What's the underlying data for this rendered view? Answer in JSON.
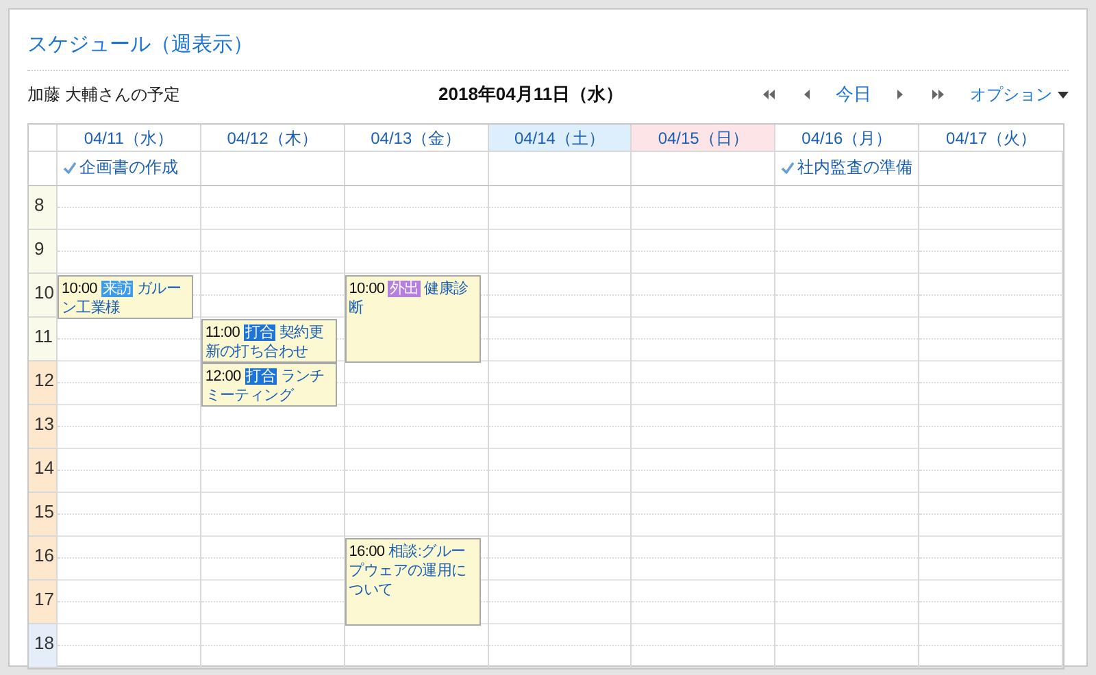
{
  "title": "スケジュール（週表示）",
  "owner": "加藤 大輔さんの予定",
  "current_date": "2018年04月11日（水）",
  "navigation": {
    "today": "今日",
    "options": "オプション"
  },
  "days": [
    {
      "label": "04/11（水）",
      "kind": "weekday",
      "all_day": [
        "企画書の作成"
      ],
      "events": [
        {
          "time": "10:00",
          "tag": "来訪",
          "color": "#3d9be9",
          "title": "ガルーン工業様",
          "kind": "one-hour"
        }
      ]
    },
    {
      "label": "04/12（木）",
      "kind": "weekday",
      "events": [
        {
          "time": "11:00",
          "tag": "打合",
          "color": "#1e74d6",
          "title": "契約更新の打ち合わせ",
          "kind": "one-hour"
        },
        {
          "time": "12:00",
          "tag": "打合",
          "color": "#1e74d6",
          "title": "ランチミーティング",
          "kind": "one-hour"
        }
      ]
    },
    {
      "label": "04/13（金）",
      "kind": "weekday",
      "events": [
        {
          "time": "10:00",
          "tag": "外出",
          "color": "#b57fe0",
          "title": "健康診断",
          "kind": "two-hour"
        },
        {
          "time": "16:00",
          "title": "相談:グループウェアの運用について",
          "kind": "two-hour"
        }
      ]
    },
    {
      "label": "04/14（土）",
      "kind": "saturday"
    },
    {
      "label": "04/15（日）",
      "kind": "sunday"
    },
    {
      "label": "04/16（月）",
      "kind": "weekday",
      "all_day": [
        "社内監査の準備"
      ]
    },
    {
      "label": "04/17（火）",
      "kind": "weekday"
    }
  ],
  "hours": [
    {
      "label": "8",
      "kind": "morning"
    },
    {
      "label": "9",
      "kind": "morning"
    },
    {
      "label": "10",
      "kind": "morning"
    },
    {
      "label": "11",
      "kind": "morning"
    },
    {
      "label": "12",
      "kind": "afternoon"
    },
    {
      "label": "13",
      "kind": "afternoon"
    },
    {
      "label": "14",
      "kind": "afternoon"
    },
    {
      "label": "15",
      "kind": "afternoon"
    },
    {
      "label": "16",
      "kind": "afternoon"
    },
    {
      "label": "17",
      "kind": "afternoon"
    },
    {
      "label": "18",
      "kind": "evening"
    }
  ]
}
